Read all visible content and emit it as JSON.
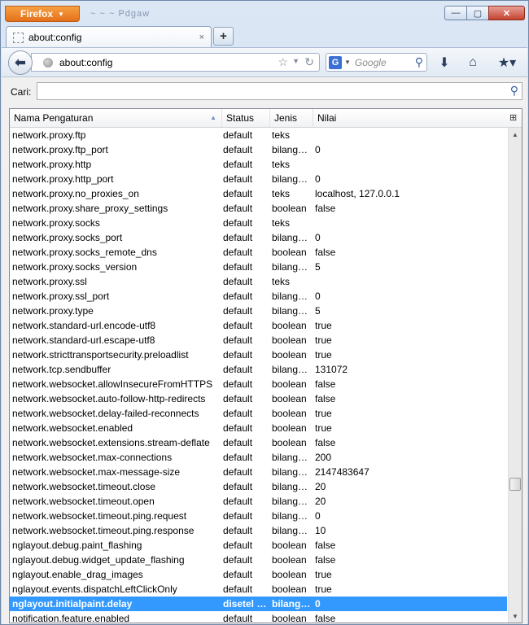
{
  "window": {
    "app_button": "Firefox",
    "title_blurred": "~ ~ ~ Pdgaw",
    "controls": {
      "minimize": "—",
      "maximize": "▢",
      "close": "✕"
    }
  },
  "tabs": [
    {
      "label": "about:config",
      "close": "×"
    }
  ],
  "new_tab_label": "+",
  "navbar": {
    "url": "about:config",
    "search_engine": "G",
    "search_placeholder": "Google"
  },
  "filter": {
    "label": "Cari:",
    "value": ""
  },
  "columns": {
    "name": "Nama Pengaturan",
    "status": "Status",
    "type": "Jenis",
    "value": "Nilai"
  },
  "rows": [
    {
      "name": "network.proxy.ftp",
      "status": "default",
      "type": "teks",
      "value": ""
    },
    {
      "name": "network.proxy.ftp_port",
      "status": "default",
      "type": "bilangan bulat",
      "value": "0"
    },
    {
      "name": "network.proxy.http",
      "status": "default",
      "type": "teks",
      "value": ""
    },
    {
      "name": "network.proxy.http_port",
      "status": "default",
      "type": "bilangan bulat",
      "value": "0"
    },
    {
      "name": "network.proxy.no_proxies_on",
      "status": "default",
      "type": "teks",
      "value": "localhost, 127.0.0.1"
    },
    {
      "name": "network.proxy.share_proxy_settings",
      "status": "default",
      "type": "boolean",
      "value": "false"
    },
    {
      "name": "network.proxy.socks",
      "status": "default",
      "type": "teks",
      "value": ""
    },
    {
      "name": "network.proxy.socks_port",
      "status": "default",
      "type": "bilangan bulat",
      "value": "0"
    },
    {
      "name": "network.proxy.socks_remote_dns",
      "status": "default",
      "type": "boolean",
      "value": "false"
    },
    {
      "name": "network.proxy.socks_version",
      "status": "default",
      "type": "bilangan bulat",
      "value": "5"
    },
    {
      "name": "network.proxy.ssl",
      "status": "default",
      "type": "teks",
      "value": ""
    },
    {
      "name": "network.proxy.ssl_port",
      "status": "default",
      "type": "bilangan bulat",
      "value": "0"
    },
    {
      "name": "network.proxy.type",
      "status": "default",
      "type": "bilangan bulat",
      "value": "5"
    },
    {
      "name": "network.standard-url.encode-utf8",
      "status": "default",
      "type": "boolean",
      "value": "true"
    },
    {
      "name": "network.standard-url.escape-utf8",
      "status": "default",
      "type": "boolean",
      "value": "true"
    },
    {
      "name": "network.stricttransportsecurity.preloadlist",
      "status": "default",
      "type": "boolean",
      "value": "true"
    },
    {
      "name": "network.tcp.sendbuffer",
      "status": "default",
      "type": "bilangan bulat",
      "value": "131072"
    },
    {
      "name": "network.websocket.allowInsecureFromHTTPS",
      "status": "default",
      "type": "boolean",
      "value": "false"
    },
    {
      "name": "network.websocket.auto-follow-http-redirects",
      "status": "default",
      "type": "boolean",
      "value": "false"
    },
    {
      "name": "network.websocket.delay-failed-reconnects",
      "status": "default",
      "type": "boolean",
      "value": "true"
    },
    {
      "name": "network.websocket.enabled",
      "status": "default",
      "type": "boolean",
      "value": "true"
    },
    {
      "name": "network.websocket.extensions.stream-deflate",
      "status": "default",
      "type": "boolean",
      "value": "false"
    },
    {
      "name": "network.websocket.max-connections",
      "status": "default",
      "type": "bilangan bulat",
      "value": "200"
    },
    {
      "name": "network.websocket.max-message-size",
      "status": "default",
      "type": "bilangan bulat",
      "value": "2147483647"
    },
    {
      "name": "network.websocket.timeout.close",
      "status": "default",
      "type": "bilangan bulat",
      "value": "20"
    },
    {
      "name": "network.websocket.timeout.open",
      "status": "default",
      "type": "bilangan bulat",
      "value": "20"
    },
    {
      "name": "network.websocket.timeout.ping.request",
      "status": "default",
      "type": "bilangan bulat",
      "value": "0"
    },
    {
      "name": "network.websocket.timeout.ping.response",
      "status": "default",
      "type": "bilangan bulat",
      "value": "10"
    },
    {
      "name": "nglayout.debug.paint_flashing",
      "status": "default",
      "type": "boolean",
      "value": "false"
    },
    {
      "name": "nglayout.debug.widget_update_flashing",
      "status": "default",
      "type": "boolean",
      "value": "false"
    },
    {
      "name": "nglayout.enable_drag_images",
      "status": "default",
      "type": "boolean",
      "value": "true"
    },
    {
      "name": "nglayout.events.dispatchLeftClickOnly",
      "status": "default",
      "type": "boolean",
      "value": "true"
    },
    {
      "name": "nglayout.initialpaint.delay",
      "status": "disetel pengguna",
      "type": "bilangan bulat",
      "value": "0",
      "selected": true
    },
    {
      "name": "notification.feature.enabled",
      "status": "default",
      "type": "boolean",
      "value": "false"
    }
  ],
  "scrollbar": {
    "position": 0.74
  },
  "colors": {
    "selection": "#3399ff",
    "firefox_orange": "#e5701b"
  }
}
